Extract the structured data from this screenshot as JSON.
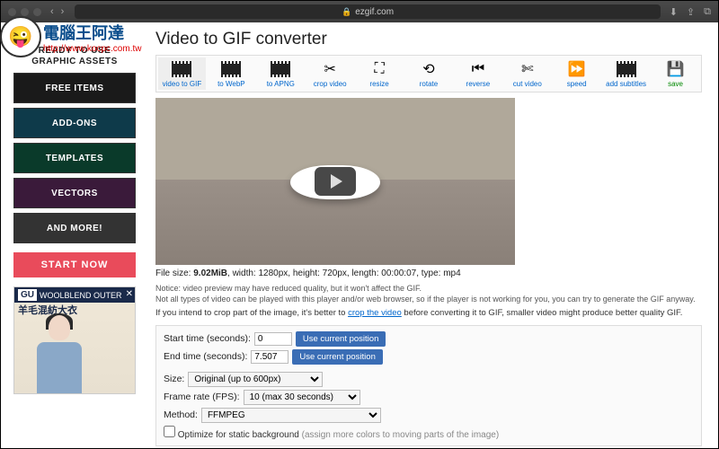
{
  "browser": {
    "url": "ezgif.com"
  },
  "watermark": {
    "cn": "電腦王阿達",
    "url": "http://www.kocpc.com.tw"
  },
  "sidebar": {
    "heading_l1": "READY TO USE",
    "heading_l2": "GRAPHIC ASSETS",
    "items": [
      "FREE ITEMS",
      "ADD-ONS",
      "TEMPLATES",
      "VECTORS",
      "AND MORE!"
    ],
    "cta": "START NOW",
    "ad": {
      "brand": "GU",
      "text": "WOOLBLEND OUTER",
      "cn": "羊毛混紡大衣"
    }
  },
  "main": {
    "title": "Video to GIF converter",
    "toolbar": [
      "video to GIF",
      "to WebP",
      "to APNG",
      "crop video",
      "resize",
      "rotate",
      "reverse",
      "cut video",
      "speed",
      "add subtitles",
      "save"
    ],
    "file_info": {
      "pre": "File size: ",
      "size": "9.02MiB",
      "rest": ", width: 1280px, height: 720px, length: 00:00:07, type: mp4"
    },
    "notice_l1": "Notice: video preview may have reduced quality, but it won't affect the GIF.",
    "notice_l2": "Not all types of video can be played with this player and/or web browser, so if the player is not working for you, you can try to generate the GIF anyway.",
    "tip_pre": "If you intend to crop part of the image, it's better to ",
    "tip_link": "crop the video",
    "tip_post": " before converting it to GIF, smaller video might produce better quality GIF.",
    "form": {
      "start_label": "Start time (seconds):",
      "start_val": "0",
      "end_label": "End time (seconds):",
      "end_val": "7.507",
      "use_pos": "Use current position",
      "size_label": "Size:",
      "size_val": "Original (up to 600px)",
      "fps_label": "Frame rate (FPS):",
      "fps_val": "10 (max 30 seconds)",
      "method_label": "Method:",
      "method_val": "FFMPEG",
      "optimize": "Optimize for static background",
      "optimize_hint": " (assign more colors to moving parts of the image)"
    }
  }
}
